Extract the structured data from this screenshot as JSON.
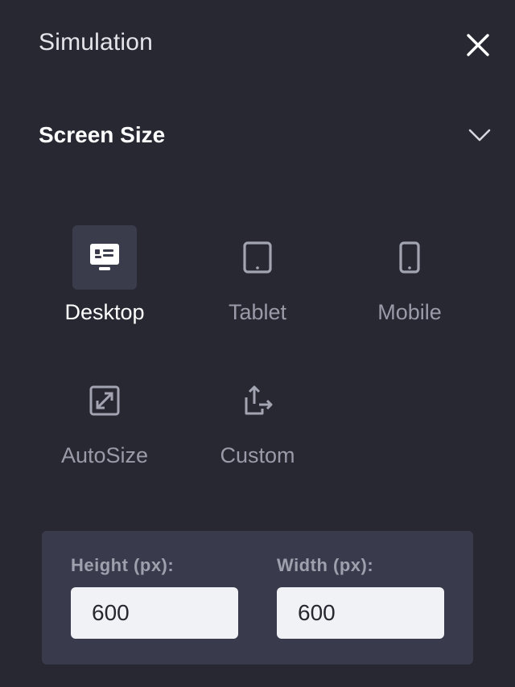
{
  "header": {
    "title": "Simulation",
    "close_icon": "close-icon"
  },
  "section": {
    "title": "Screen Size",
    "expanded": true,
    "toggle_icon": "chevron-down-icon"
  },
  "options": [
    {
      "label": "Desktop",
      "icon": "desktop-icon",
      "selected": true
    },
    {
      "label": "Tablet",
      "icon": "tablet-icon",
      "selected": false
    },
    {
      "label": "Mobile",
      "icon": "mobile-icon",
      "selected": false
    },
    {
      "label": "AutoSize",
      "icon": "autosize-icon",
      "selected": false
    },
    {
      "label": "Custom",
      "icon": "custom-icon",
      "selected": false
    }
  ],
  "custom_size": {
    "height_label": "Height (px):",
    "height_value": "600",
    "width_label": "Width (px):",
    "width_value": "600"
  },
  "colors": {
    "background": "#272832",
    "selected_tile": "#3b3c4b",
    "card": "#393a4b",
    "input": "#f1f2f6",
    "inactive_text": "#9a9ba8"
  }
}
